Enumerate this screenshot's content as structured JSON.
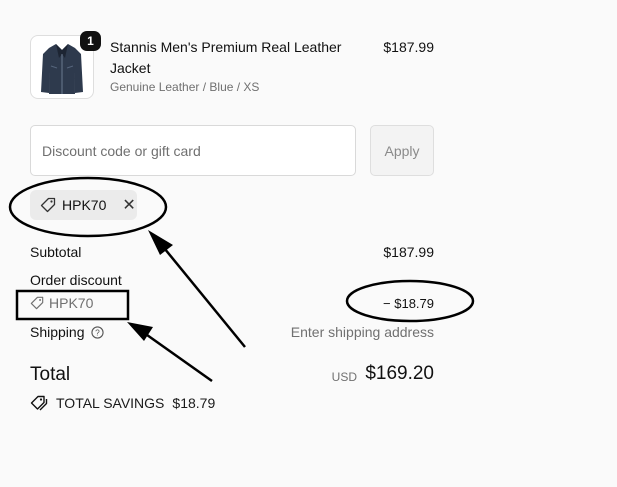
{
  "cart": {
    "quantity": "1",
    "product_title": "Stannis Men's Premium Real Leather Jacket",
    "product_variant": "Genuine Leather / Blue / XS",
    "product_price": "$187.99"
  },
  "discount": {
    "placeholder": "Discount code or gift card",
    "apply_label": "Apply",
    "applied_code": "HPK70"
  },
  "summary": {
    "subtotal_label": "Subtotal",
    "subtotal_value": "$187.99",
    "order_discount_label": "Order discount",
    "discount_code": "HPK70",
    "discount_value": "− $18.79",
    "shipping_label": "Shipping",
    "shipping_value": "Enter shipping address",
    "total_label": "Total",
    "currency": "USD",
    "total_value": "$169.20",
    "savings_label": "TOTAL SAVINGS",
    "savings_value": "$18.79"
  },
  "colors": {
    "annotation": "#000000",
    "badge": "#111111",
    "chip_bg": "#ebebeb"
  }
}
